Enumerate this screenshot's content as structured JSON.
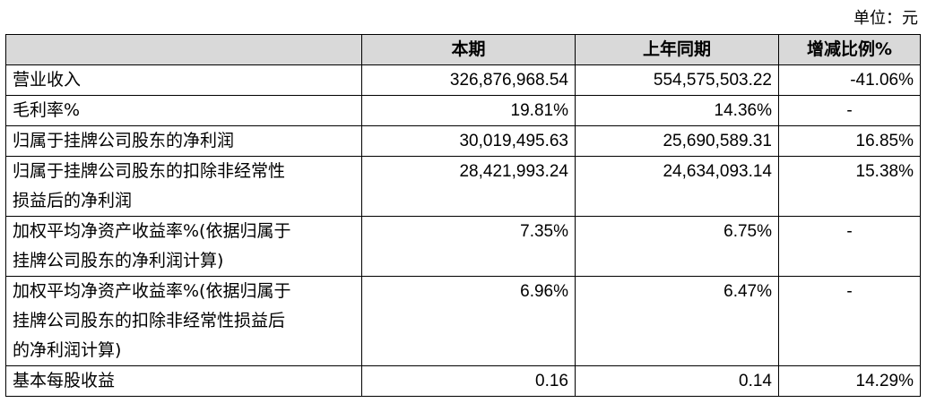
{
  "unit_label": "单位：元",
  "table": {
    "headers": [
      "",
      "本期",
      "上年同期",
      "增减比例%"
    ],
    "rows": [
      {
        "label": "营业收入",
        "current": "326,876,968.54",
        "prior": "554,575,503.22",
        "change": "-41.06%"
      },
      {
        "label": "毛利率%",
        "current": "19.81%",
        "prior": "14.36%",
        "change": "-"
      },
      {
        "label": "归属于挂牌公司股东的净利润",
        "current": "30,019,495.63",
        "prior": "25,690,589.31",
        "change": "16.85%"
      },
      {
        "label": "归属于挂牌公司股东的扣除非经常性\n损益后的净利润",
        "current": "28,421,993.24",
        "prior": "24,634,093.14",
        "change": "15.38%"
      },
      {
        "label": "加权平均净资产收益率%(依据归属于\n挂牌公司股东的净利润计算)",
        "current": "7.35%",
        "prior": "6.75%",
        "change": "-"
      },
      {
        "label": "加权平均净资产收益率%(依据归属于\n挂牌公司股东的扣除非经常性损益后\n的净利润计算)",
        "current": "6.96%",
        "prior": "6.47%",
        "change": "-"
      },
      {
        "label": "基本每股收益",
        "current": "0.16",
        "prior": "0.14",
        "change": "14.29%"
      }
    ]
  }
}
